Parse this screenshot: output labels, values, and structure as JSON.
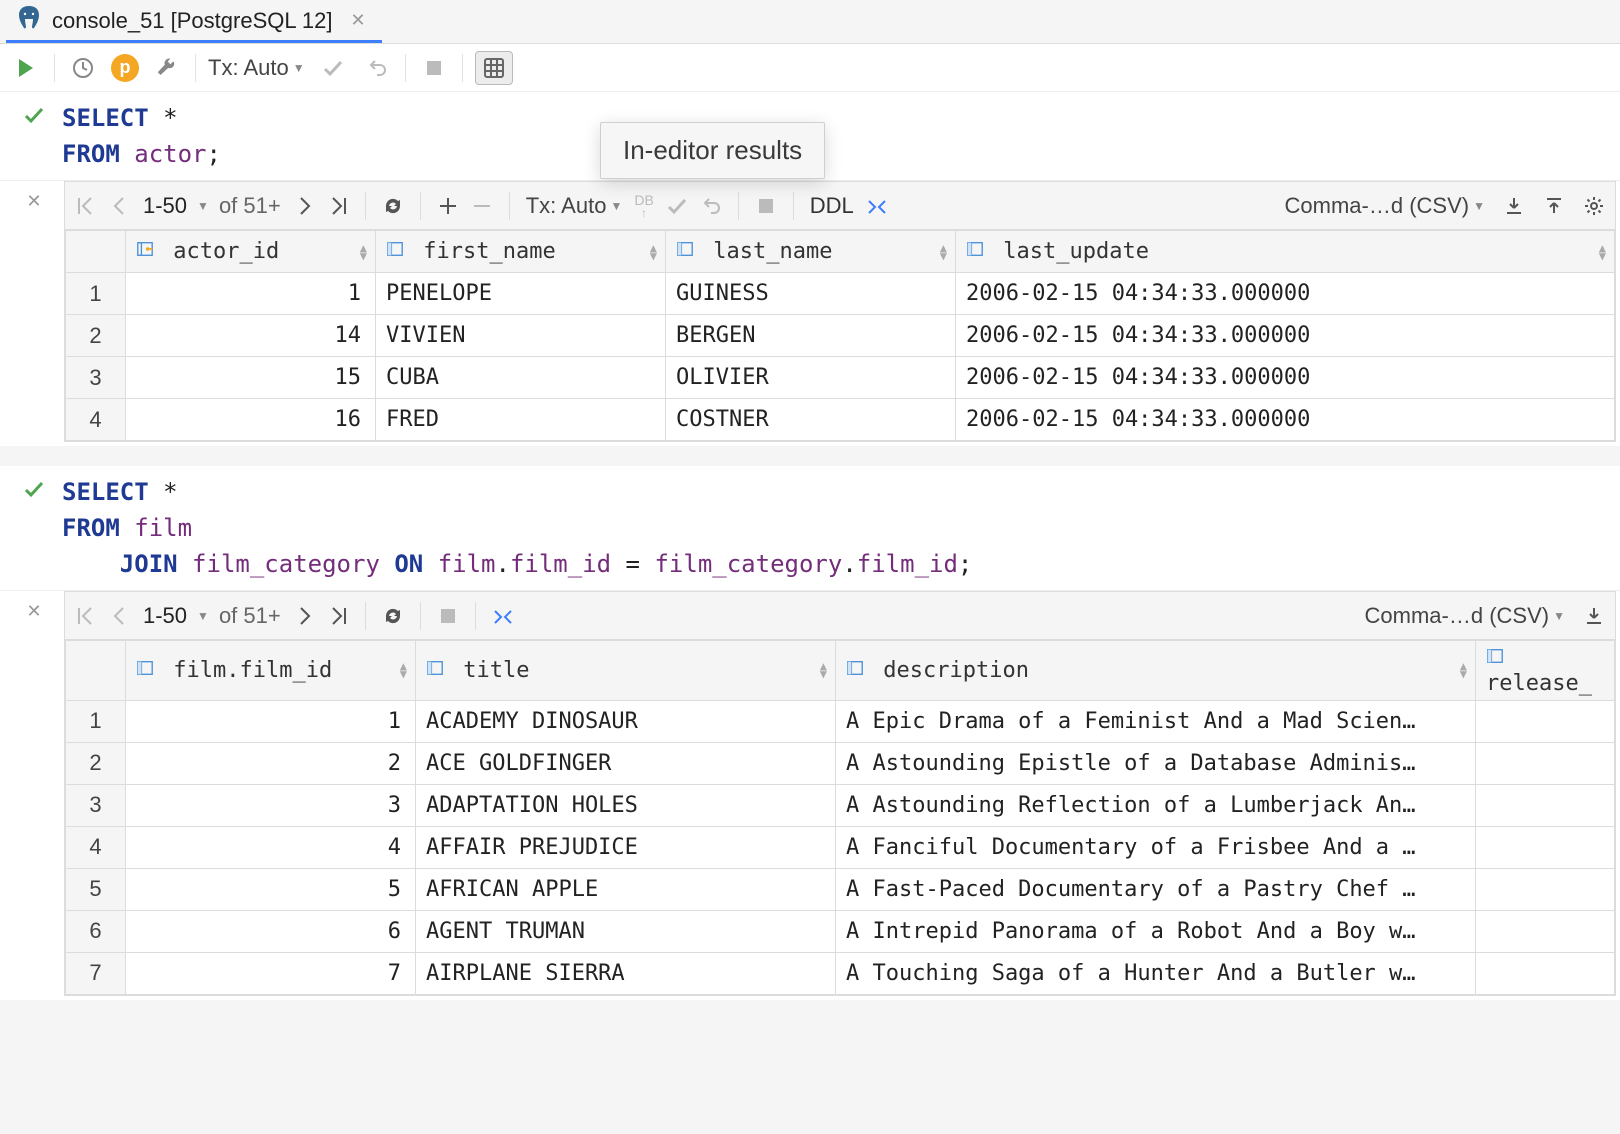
{
  "tab": {
    "label": "console_51 [PostgreSQL 12]"
  },
  "toolbar": {
    "tx_label": "Tx: Auto",
    "paused_label": "p"
  },
  "tooltip": {
    "text": "In-editor results"
  },
  "query1": {
    "code_html": "<span class='kw'>SELECT</span> *\n<span class='kw'>FROM</span> <span class='id'>actor</span>;"
  },
  "results1": {
    "pager_range": "1-50",
    "pager_total": "of 51+",
    "tx_label": "Tx: Auto",
    "db_label": "DB",
    "ddl_label": "DDL",
    "csv_label": "Comma-…d (CSV)",
    "columns": [
      "actor_id",
      "first_name",
      "last_name",
      "last_update"
    ],
    "rows": [
      {
        "n": "1",
        "actor_id": "1",
        "first_name": "PENELOPE",
        "last_name": "GUINESS",
        "last_update": "2006-02-15 04:34:33.000000"
      },
      {
        "n": "2",
        "actor_id": "14",
        "first_name": "VIVIEN",
        "last_name": "BERGEN",
        "last_update": "2006-02-15 04:34:33.000000"
      },
      {
        "n": "3",
        "actor_id": "15",
        "first_name": "CUBA",
        "last_name": "OLIVIER",
        "last_update": "2006-02-15 04:34:33.000000"
      },
      {
        "n": "4",
        "actor_id": "16",
        "first_name": "FRED",
        "last_name": "COSTNER",
        "last_update": "2006-02-15 04:34:33.000000"
      }
    ]
  },
  "query2": {
    "code_html": "<span class='kw'>SELECT</span> *\n<span class='kw'>FROM</span> <span class='id'>film</span>\n    <span class='kw'>JOIN</span> <span class='id'>film_category</span> <span class='kw'>ON</span> <span class='id'>film</span>.<span class='id'>film_id</span> = <span class='id'>film_category</span>.<span class='id'>film_id</span>;"
  },
  "results2": {
    "pager_range": "1-50",
    "pager_total": "of 51+",
    "csv_label": "Comma-…d (CSV)",
    "columns": [
      "film.film_id",
      "title",
      "description",
      "release_"
    ],
    "rows": [
      {
        "n": "1",
        "film_id": "1",
        "title": "ACADEMY DINOSAUR",
        "description": "A Epic Drama of a Feminist And a Mad Scien…"
      },
      {
        "n": "2",
        "film_id": "2",
        "title": "ACE GOLDFINGER",
        "description": "A Astounding Epistle of a Database Adminis…"
      },
      {
        "n": "3",
        "film_id": "3",
        "title": "ADAPTATION HOLES",
        "description": "A Astounding Reflection of a Lumberjack An…"
      },
      {
        "n": "4",
        "film_id": "4",
        "title": "AFFAIR PREJUDICE",
        "description": "A Fanciful Documentary of a Frisbee And a …"
      },
      {
        "n": "5",
        "film_id": "5",
        "title": "AFRICAN APPLE",
        "description": "A Fast-Paced Documentary of a Pastry Chef …"
      },
      {
        "n": "6",
        "film_id": "6",
        "title": "AGENT TRUMAN",
        "description": "A Intrepid Panorama of a Robot And a Boy w…"
      },
      {
        "n": "7",
        "film_id": "7",
        "title": "AIRPLANE SIERRA",
        "description": "A Touching Saga of a Hunter And a Butler w…"
      }
    ]
  }
}
